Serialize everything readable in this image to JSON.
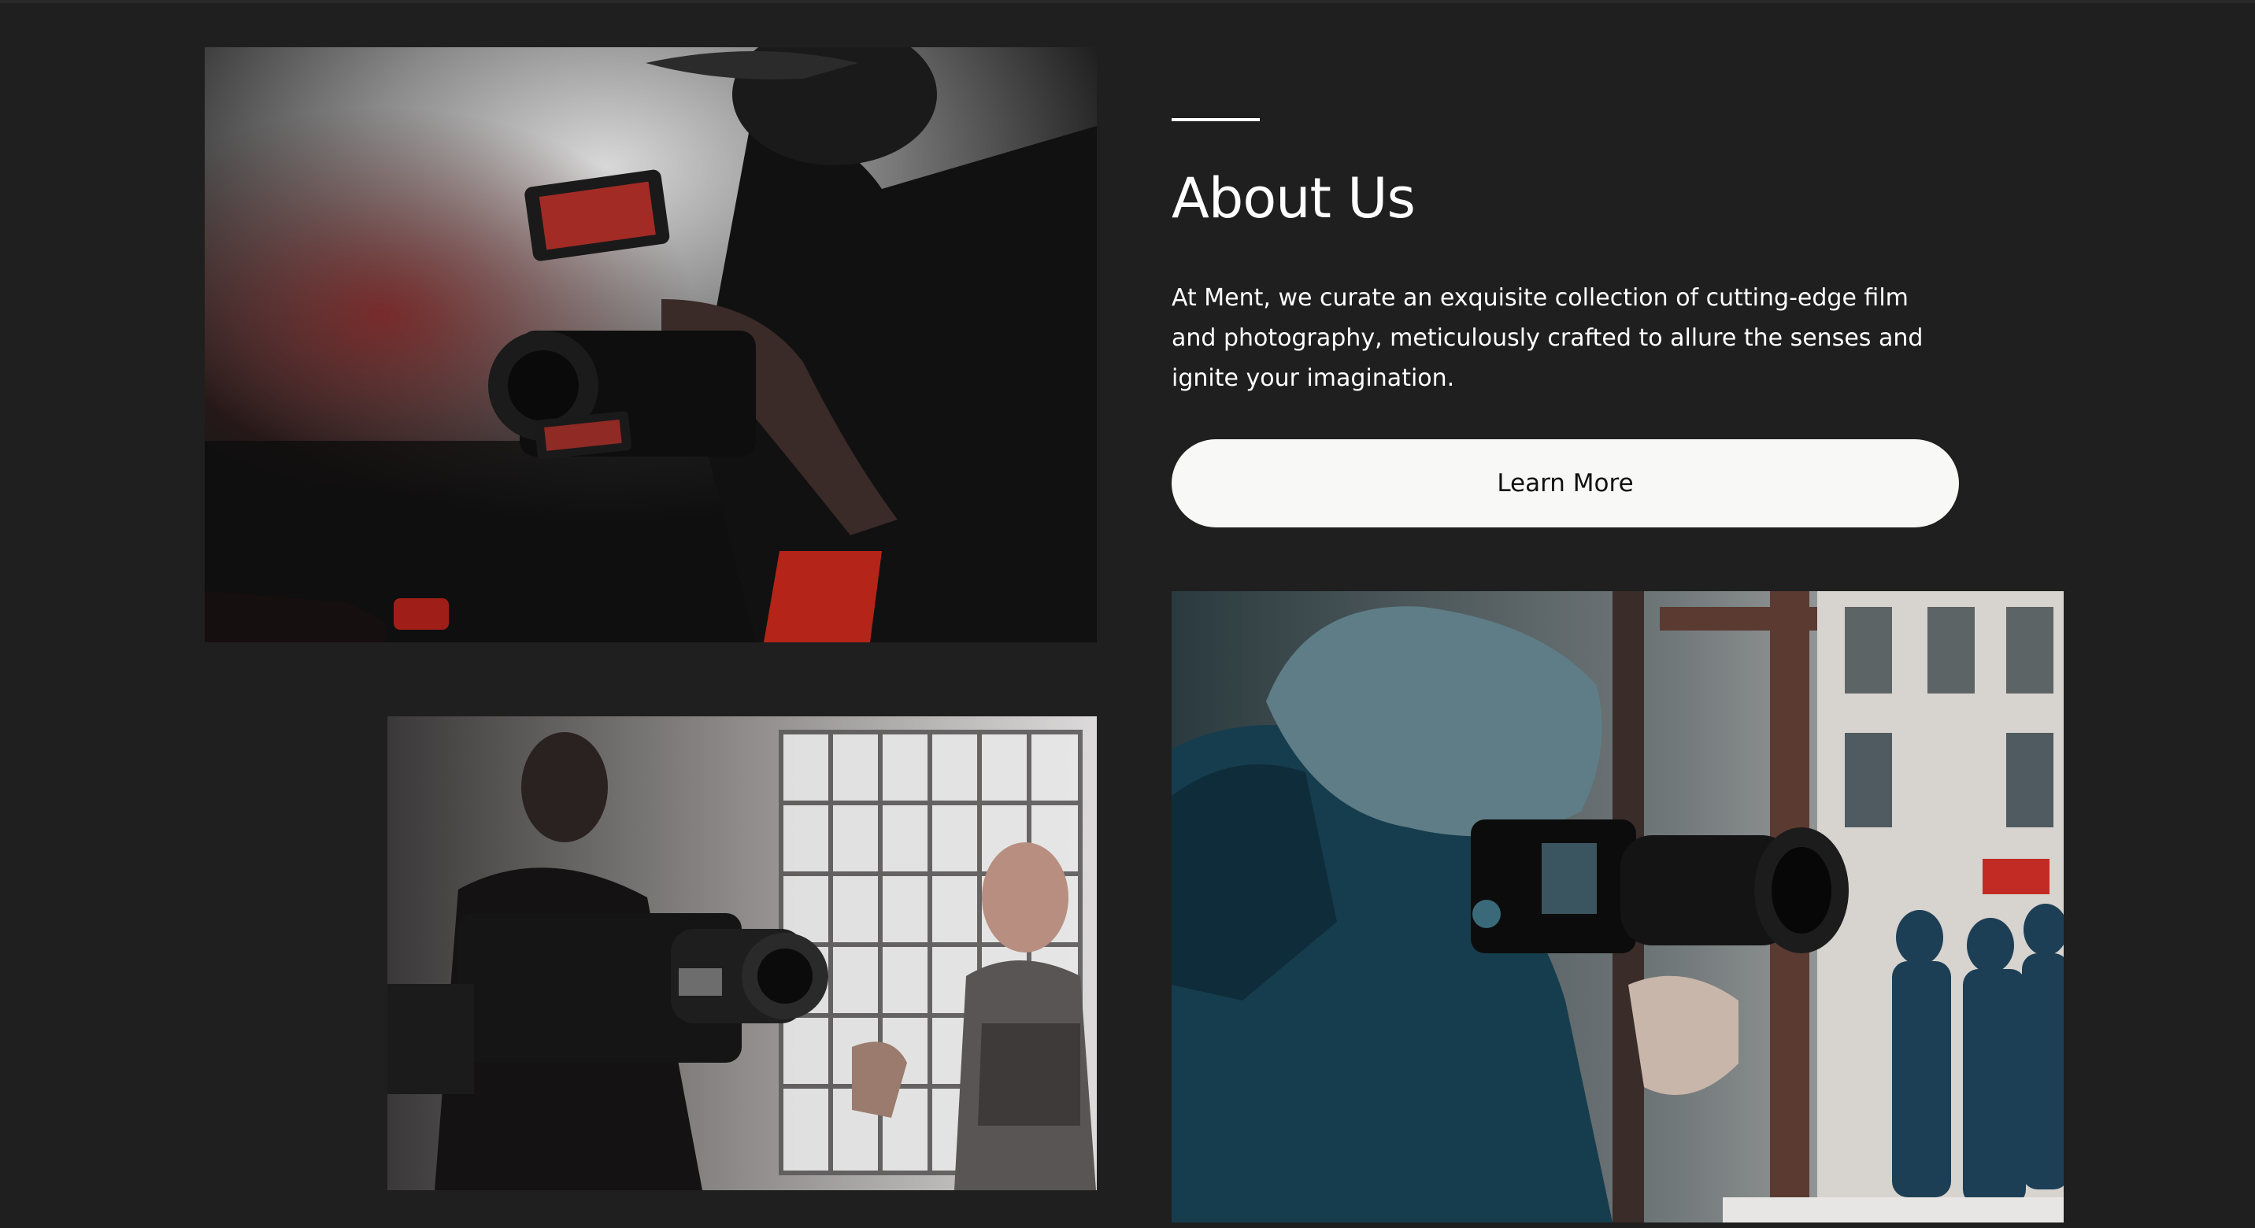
{
  "about": {
    "title": "About Us",
    "description": "At Ment, we curate an exquisite collection of cutting-edge film and photography, meticulously crafted to allure the senses and ignite your imagination.",
    "button_label": "Learn More"
  },
  "colors": {
    "background": "#1f1f1f",
    "text": "#ffffff",
    "button_bg": "#f8f8f6",
    "button_text": "#111111"
  }
}
